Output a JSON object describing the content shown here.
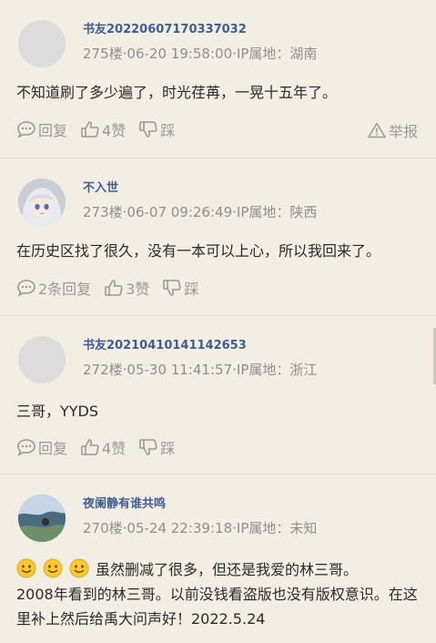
{
  "comments": [
    {
      "username": "书友20220607170337032",
      "meta": "275楼·06-20 19:58:00·IP属地：湖南",
      "text": "不知道刷了多少遍了，时光荏苒，一晃十五年了。",
      "reply_label": "回复",
      "like_label": "4赞",
      "dislike_label": "踩",
      "report_label": "举报"
    },
    {
      "username": "不入世",
      "meta": "273楼·06-07 09:26:49·IP属地：陕西",
      "text": "在历史区找了很久，没有一本可以上心，所以我回来了。",
      "reply_label": "2条回复",
      "like_label": "3赞",
      "dislike_label": "踩"
    },
    {
      "username": "书友20210410141142653",
      "meta": "272楼·05-30 11:41:57·IP属地：浙江",
      "text": "三哥，YYDS",
      "reply_label": "回复",
      "like_label": "4赞",
      "dislike_label": "踩"
    },
    {
      "username": "夜阑静有谁共鸣",
      "meta": "270楼·05-24 22:39:18·IP属地：未知",
      "text_line1": "虽然删减了很多，但还是我爱的林三哥。",
      "text_rest": "2008年看到的林三哥。以前没钱看盗版也没有版权意识。在这里补上然后给禹大问声好！2022.5.24",
      "emojis": [
        "smile-emoji",
        "smile-emoji",
        "smile-emoji"
      ]
    }
  ],
  "colors": {
    "background": "#f3eee3",
    "username": "#3f5d8f",
    "meta": "#8e8e8e",
    "action": "#999999"
  }
}
